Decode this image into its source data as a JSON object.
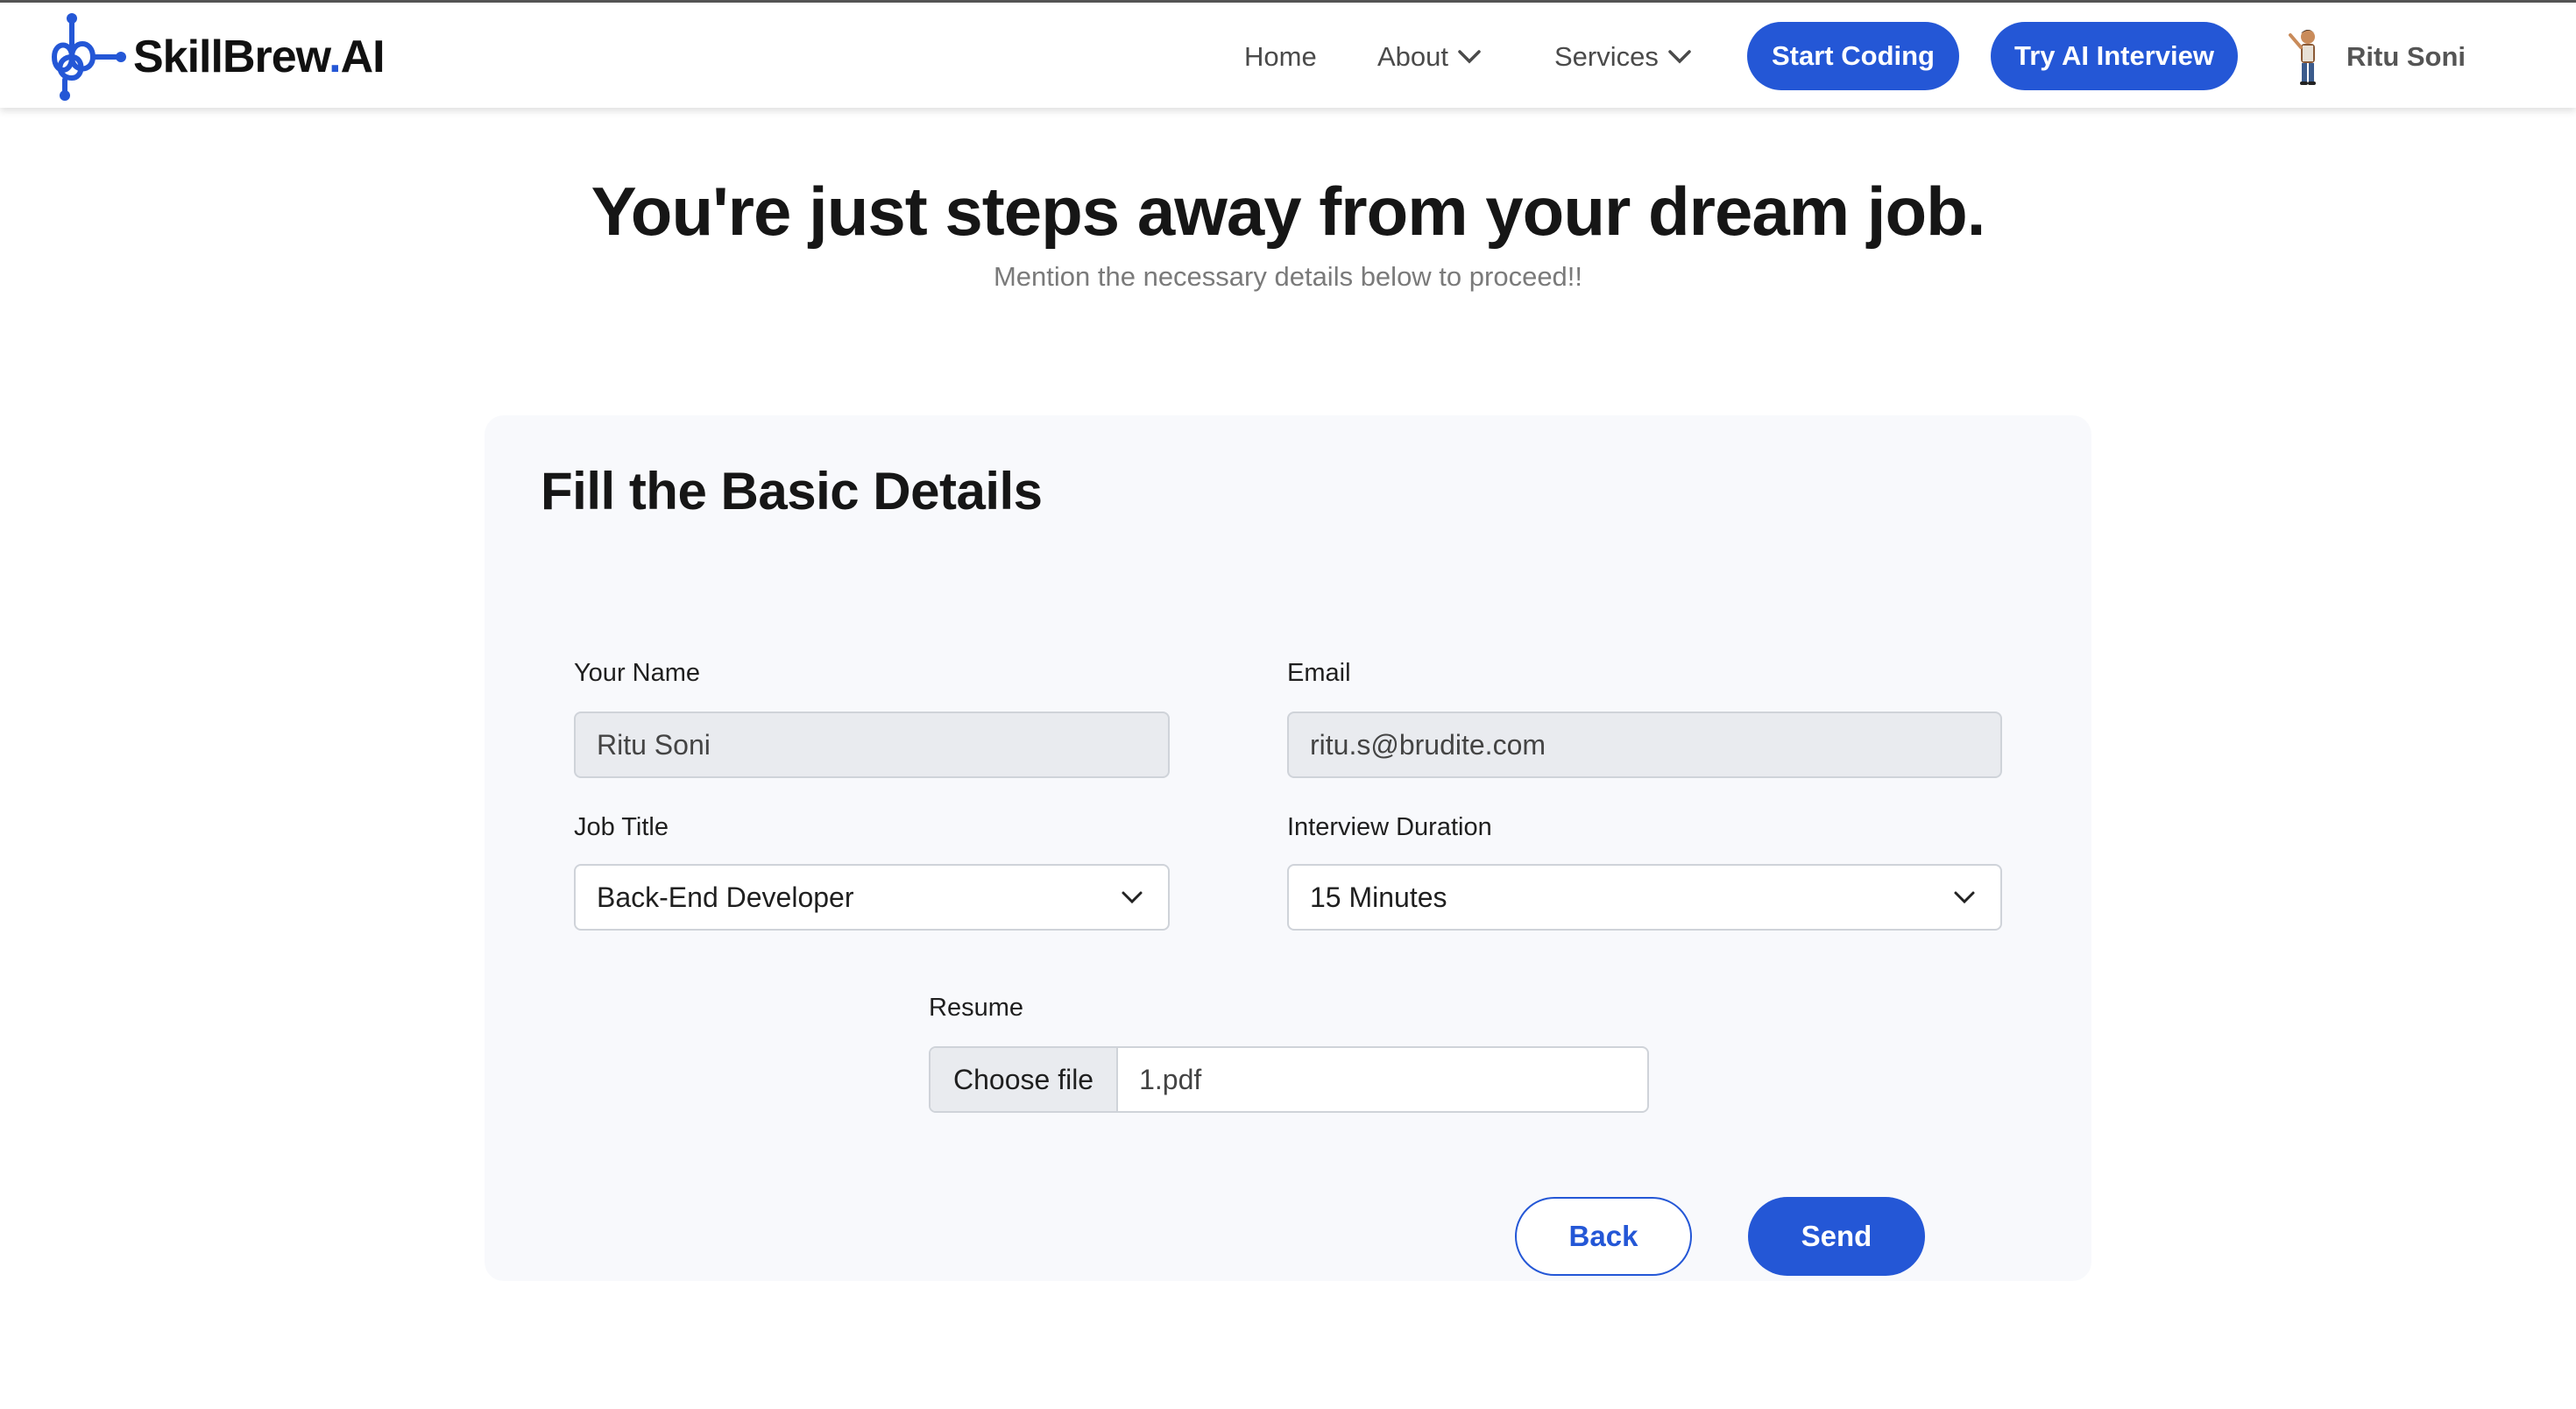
{
  "brand": {
    "name_main": "SkillBrew",
    "name_dot": ".",
    "name_suffix": "AI",
    "accent": "#2457d6"
  },
  "nav": {
    "home": "Home",
    "about": "About",
    "services": "Services",
    "start_coding": "Start Coding",
    "try_ai_interview": "Try AI Interview",
    "user_name": "Ritu Soni"
  },
  "hero": {
    "title": "You're just steps away from your dream job.",
    "subtitle": "Mention the necessary details below to proceed!!"
  },
  "form": {
    "title": "Fill the Basic Details",
    "name_label": "Your Name",
    "name_value": "Ritu Soni",
    "email_label": "Email",
    "email_value": "ritu.s@brudite.com",
    "job_label": "Job Title",
    "job_value": "Back-End Developer",
    "duration_label": "Interview Duration",
    "duration_value": "15 Minutes",
    "resume_label": "Resume",
    "file_button": "Choose file",
    "file_name": "1.pdf",
    "back_label": "Back",
    "send_label": "Send"
  }
}
